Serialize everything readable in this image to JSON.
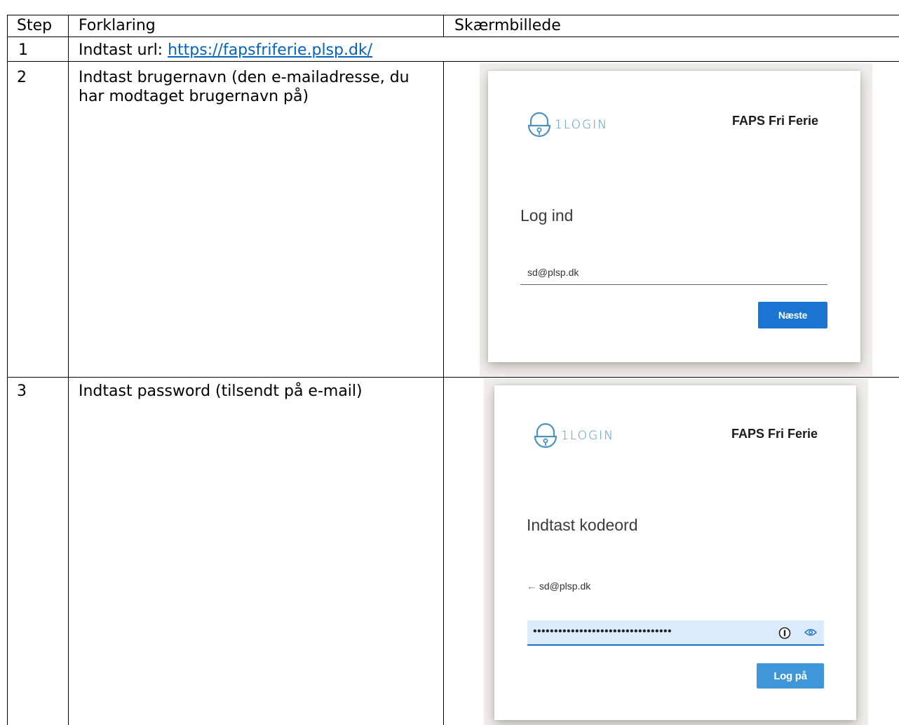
{
  "table": {
    "headers": {
      "step": "Step",
      "explanation": "Forklaring",
      "screenshot": "Skærmbillede"
    },
    "rows": [
      {
        "step": "1",
        "prefix": "Indtast url: ",
        "link": "https://fapsfriferie.plsp.dk/"
      },
      {
        "step": "2",
        "text": "Indtast brugernavn (den e-mailadresse, du har modtaget brugernavn på)"
      },
      {
        "step": "3",
        "text": "Indtast password (tilsendt på e-mail)"
      }
    ]
  },
  "login_step": {
    "logo_text": "1LOGIN",
    "brand": "FAPS Fri Ferie",
    "title": "Log ind",
    "username_value": "sd@plsp.dk",
    "next_button": "Næste"
  },
  "password_step": {
    "logo_text": "1LOGIN",
    "brand": "FAPS Fri Ferie",
    "title": "Indtast kodeord",
    "back_email": "sd@plsp.dk",
    "back_arrow": "←",
    "password_mask": "•••••••••••••••••••••••••••••••••",
    "login_button": "Log på"
  },
  "colors": {
    "link": "#0563c1",
    "button": "#1a75d1",
    "logo": "#4a92bd",
    "field": "#dcebfb"
  }
}
